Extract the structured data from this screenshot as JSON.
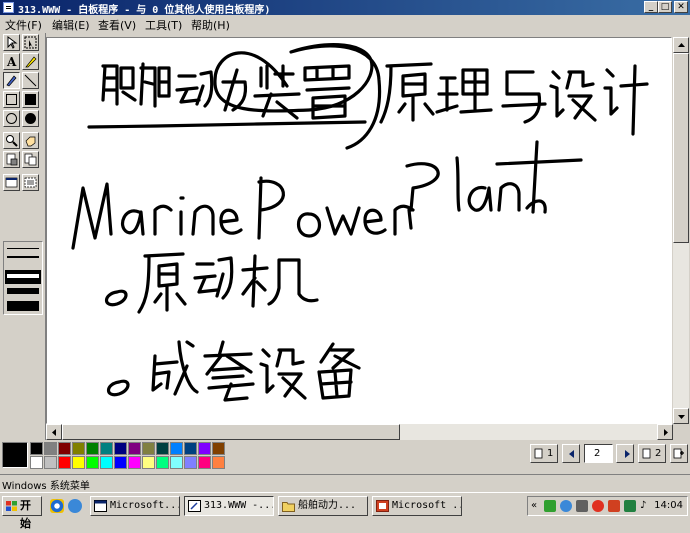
{
  "window": {
    "title": "313.WWW - 白板程序 - 与 0 位其他人使用白板程序)"
  },
  "menu": {
    "items": [
      "文件(F)",
      "编辑(E)",
      "查看(V)",
      "工具(T)",
      "帮助(H)"
    ]
  },
  "tools": {
    "icons": [
      "select-arrow-icon",
      "select-area-icon",
      "text-icon",
      "highlighter-icon",
      "pen-icon",
      "line-icon",
      "hollow-rect-icon",
      "filled-rect-icon",
      "hollow-ellipse-icon",
      "filled-ellipse-icon",
      "zoom-icon",
      "remote-pointer-icon",
      "lock-contents-icon",
      "synchronize-icon",
      "select-window-icon",
      "select-area-capture-icon"
    ]
  },
  "canvas": {
    "handwriting": {
      "line1": "船舶动力装置原理与设计",
      "line2": "Marine Power Plant",
      "bullet1": "原动机",
      "bullet2": "成套设备"
    }
  },
  "palette": {
    "current_color": "#000000",
    "colors_row1": [
      "#000000",
      "#808080",
      "#800000",
      "#808000",
      "#008000",
      "#008080",
      "#000080",
      "#800080",
      "#808040",
      "#004040",
      "#0080ff",
      "#004080",
      "#8000ff",
      "#804000"
    ],
    "colors_row2": [
      "#ffffff",
      "#c0c0c0",
      "#ff0000",
      "#ffff00",
      "#00ff00",
      "#00ffff",
      "#0000ff",
      "#ff00ff",
      "#ffff80",
      "#00ff80",
      "#80ffff",
      "#8080ff",
      "#ff0080",
      "#ff8040"
    ]
  },
  "pagenav": {
    "first_page": "1",
    "current_page": "2",
    "last_page": "2"
  },
  "status": {
    "text": "Windows 系统菜单"
  },
  "taskbar": {
    "start_label": "开始",
    "tasks": [
      {
        "label": "Microsoft...",
        "icon": "window-icon",
        "active": false
      },
      {
        "label": "313.WWW -...",
        "icon": "whiteboard-icon",
        "active": true
      },
      {
        "label": "船舶动力...",
        "icon": "folder-icon",
        "active": false
      },
      {
        "label": "Microsoft ...",
        "icon": "presentation-icon",
        "active": false
      }
    ],
    "clock": "14:04"
  }
}
